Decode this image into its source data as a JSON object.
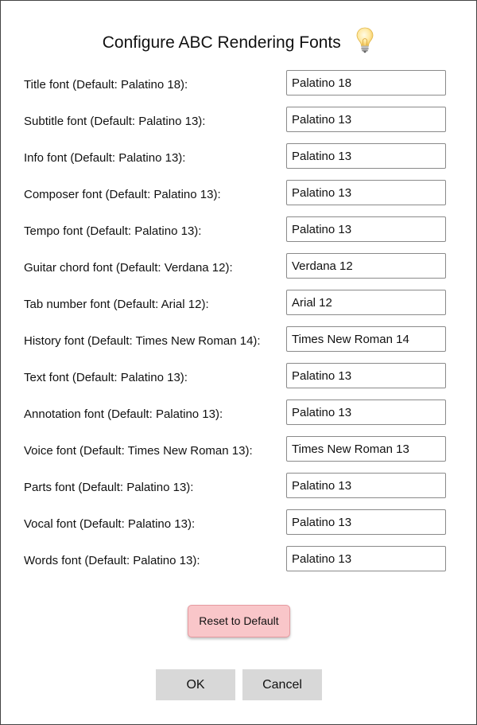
{
  "dialog": {
    "title": "Configure ABC Rendering Fonts",
    "icon": "lightbulb-icon"
  },
  "fonts": [
    {
      "label": "Title font (Default: Palatino 18):",
      "value": "Palatino 18"
    },
    {
      "label": "Subtitle font (Default: Palatino 13):",
      "value": "Palatino 13"
    },
    {
      "label": "Info font (Default: Palatino 13):",
      "value": "Palatino 13"
    },
    {
      "label": "Composer font (Default: Palatino 13):",
      "value": "Palatino 13"
    },
    {
      "label": "Tempo font (Default: Palatino 13):",
      "value": "Palatino 13"
    },
    {
      "label": "Guitar chord font (Default: Verdana 12):",
      "value": "Verdana 12"
    },
    {
      "label": "Tab number font (Default: Arial 12):",
      "value": "Arial 12"
    },
    {
      "label": "History font (Default: Times New Roman 14):",
      "value": "Times New Roman 14"
    },
    {
      "label": "Text font (Default: Palatino 13):",
      "value": "Palatino 13"
    },
    {
      "label": "Annotation font (Default: Palatino 13):",
      "value": "Palatino 13"
    },
    {
      "label": "Voice font (Default: Times New Roman 13):",
      "value": "Times New Roman 13"
    },
    {
      "label": "Parts font (Default: Palatino 13):",
      "value": "Palatino 13"
    },
    {
      "label": "Vocal font (Default: Palatino 13):",
      "value": "Palatino 13"
    },
    {
      "label": "Words font (Default: Palatino 13):",
      "value": "Palatino 13"
    }
  ],
  "buttons": {
    "reset": "Reset to Default",
    "ok": "OK",
    "cancel": "Cancel"
  },
  "colors": {
    "reset_bg": "#f9c6c9",
    "button_bg": "#d8d8d8"
  }
}
